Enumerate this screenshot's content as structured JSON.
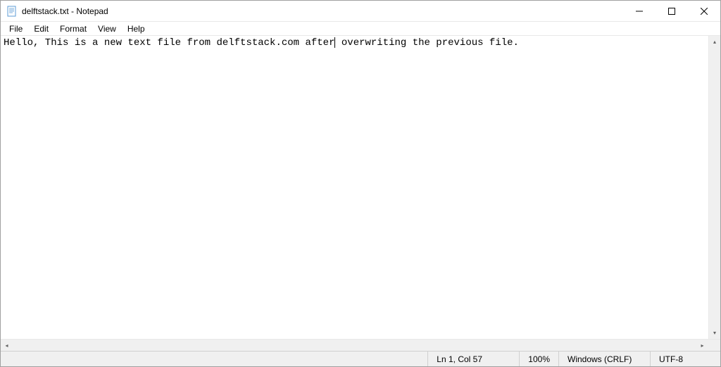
{
  "window": {
    "title": "delftstack.txt - Notepad"
  },
  "menu": {
    "file": "File",
    "edit": "Edit",
    "format": "Format",
    "view": "View",
    "help": "Help"
  },
  "editor": {
    "text_before_cursor": "Hello, This is a new text file from delftstack.com after",
    "text_after_cursor": " overwriting the previous file."
  },
  "statusbar": {
    "cursor_position": "Ln 1, Col 57",
    "zoom": "100%",
    "line_ending": "Windows (CRLF)",
    "encoding": "UTF-8"
  }
}
